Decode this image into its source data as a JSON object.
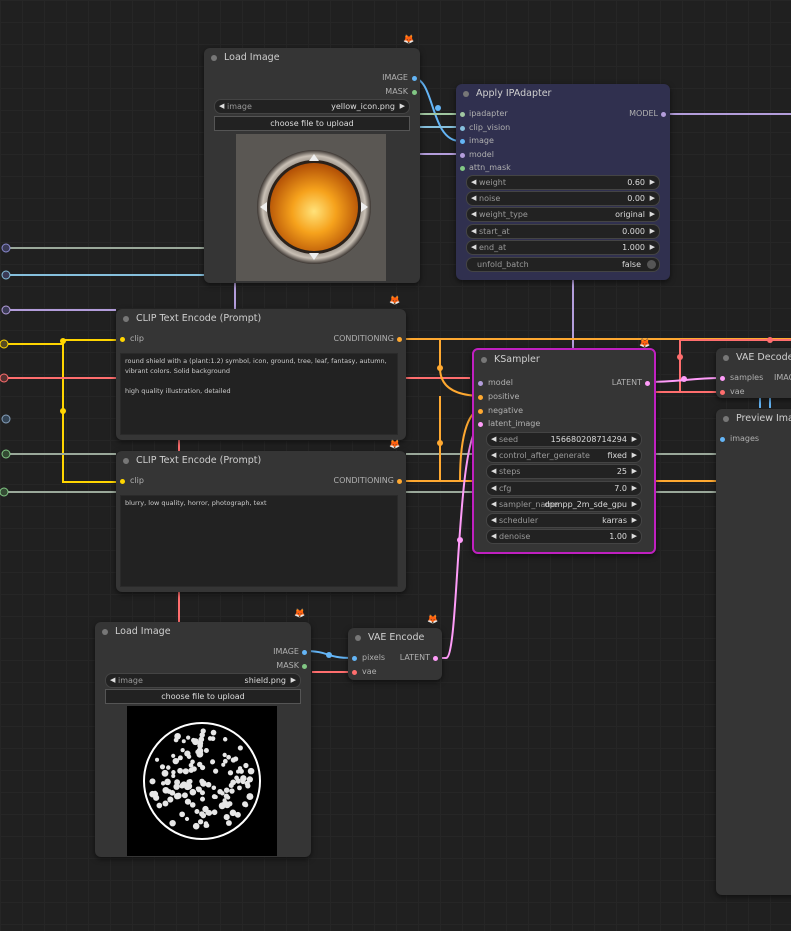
{
  "nodes": {
    "load_image_1": {
      "title": "Load Image",
      "outputs": [
        "IMAGE",
        "MASK"
      ],
      "image_label": "image",
      "image_value": "yellow_icon.png",
      "upload_label": "choose file to upload"
    },
    "apply_ipadapter": {
      "title": "Apply IPAdapter",
      "inputs": [
        "ipadapter",
        "clip_vision",
        "image",
        "model",
        "attn_mask"
      ],
      "output": "MODEL",
      "widgets": [
        {
          "label": "weight",
          "value": "0.60"
        },
        {
          "label": "noise",
          "value": "0.00"
        },
        {
          "label": "weight_type",
          "value": "original"
        },
        {
          "label": "start_at",
          "value": "0.000"
        },
        {
          "label": "end_at",
          "value": "1.000"
        }
      ],
      "toggle": {
        "label": "unfold_batch",
        "value": "false"
      }
    },
    "clip_text_1": {
      "title": "CLIP Text Encode (Prompt)",
      "input": "clip",
      "output": "CONDITIONING",
      "text": "round shield with a (plant:1.2) symbol, icon, ground, tree, leaf, fantasy, autumn, vibrant colors. Solid background\n\nhigh quality illustration, detailed"
    },
    "clip_text_2": {
      "title": "CLIP Text Encode (Prompt)",
      "input": "clip",
      "output": "CONDITIONING",
      "text": "blurry, low quality, horror, photograph, text"
    },
    "ksampler": {
      "title": "KSampler",
      "inputs": [
        "model",
        "positive",
        "negative",
        "latent_image"
      ],
      "output": "LATENT",
      "widgets": [
        {
          "label": "seed",
          "value": "156680208714294"
        },
        {
          "label": "control_after_generate",
          "value": "fixed"
        },
        {
          "label": "steps",
          "value": "25"
        },
        {
          "label": "cfg",
          "value": "7.0"
        },
        {
          "label": "sampler_name",
          "value": "dpmpp_2m_sde_gpu"
        },
        {
          "label": "scheduler",
          "value": "karras"
        },
        {
          "label": "denoise",
          "value": "1.00"
        }
      ]
    },
    "vae_decode": {
      "title": "VAE Decode",
      "inputs": [
        "samples",
        "vae"
      ],
      "output": "IMAG"
    },
    "preview_image": {
      "title": "Preview Imag",
      "input": "images"
    },
    "load_image_2": {
      "title": "Load Image",
      "outputs": [
        "IMAGE",
        "MASK"
      ],
      "image_label": "image",
      "image_value": "shield.png",
      "upload_label": "choose file to upload"
    },
    "vae_encode": {
      "title": "VAE Encode",
      "inputs": [
        "pixels",
        "vae"
      ],
      "output": "LATENT"
    }
  },
  "colors": {
    "image": "#64b5f6",
    "model": "#b39ddb",
    "clip": "#ffd500",
    "conditioning": "#ffa931",
    "latent": "#ff9cf9",
    "vae": "#ff6e6e",
    "mask": "#81c784",
    "clip_vision": "#a1c7a1",
    "ksampler_border": "#c020c0",
    "ipadapter_bg": "#333355"
  }
}
